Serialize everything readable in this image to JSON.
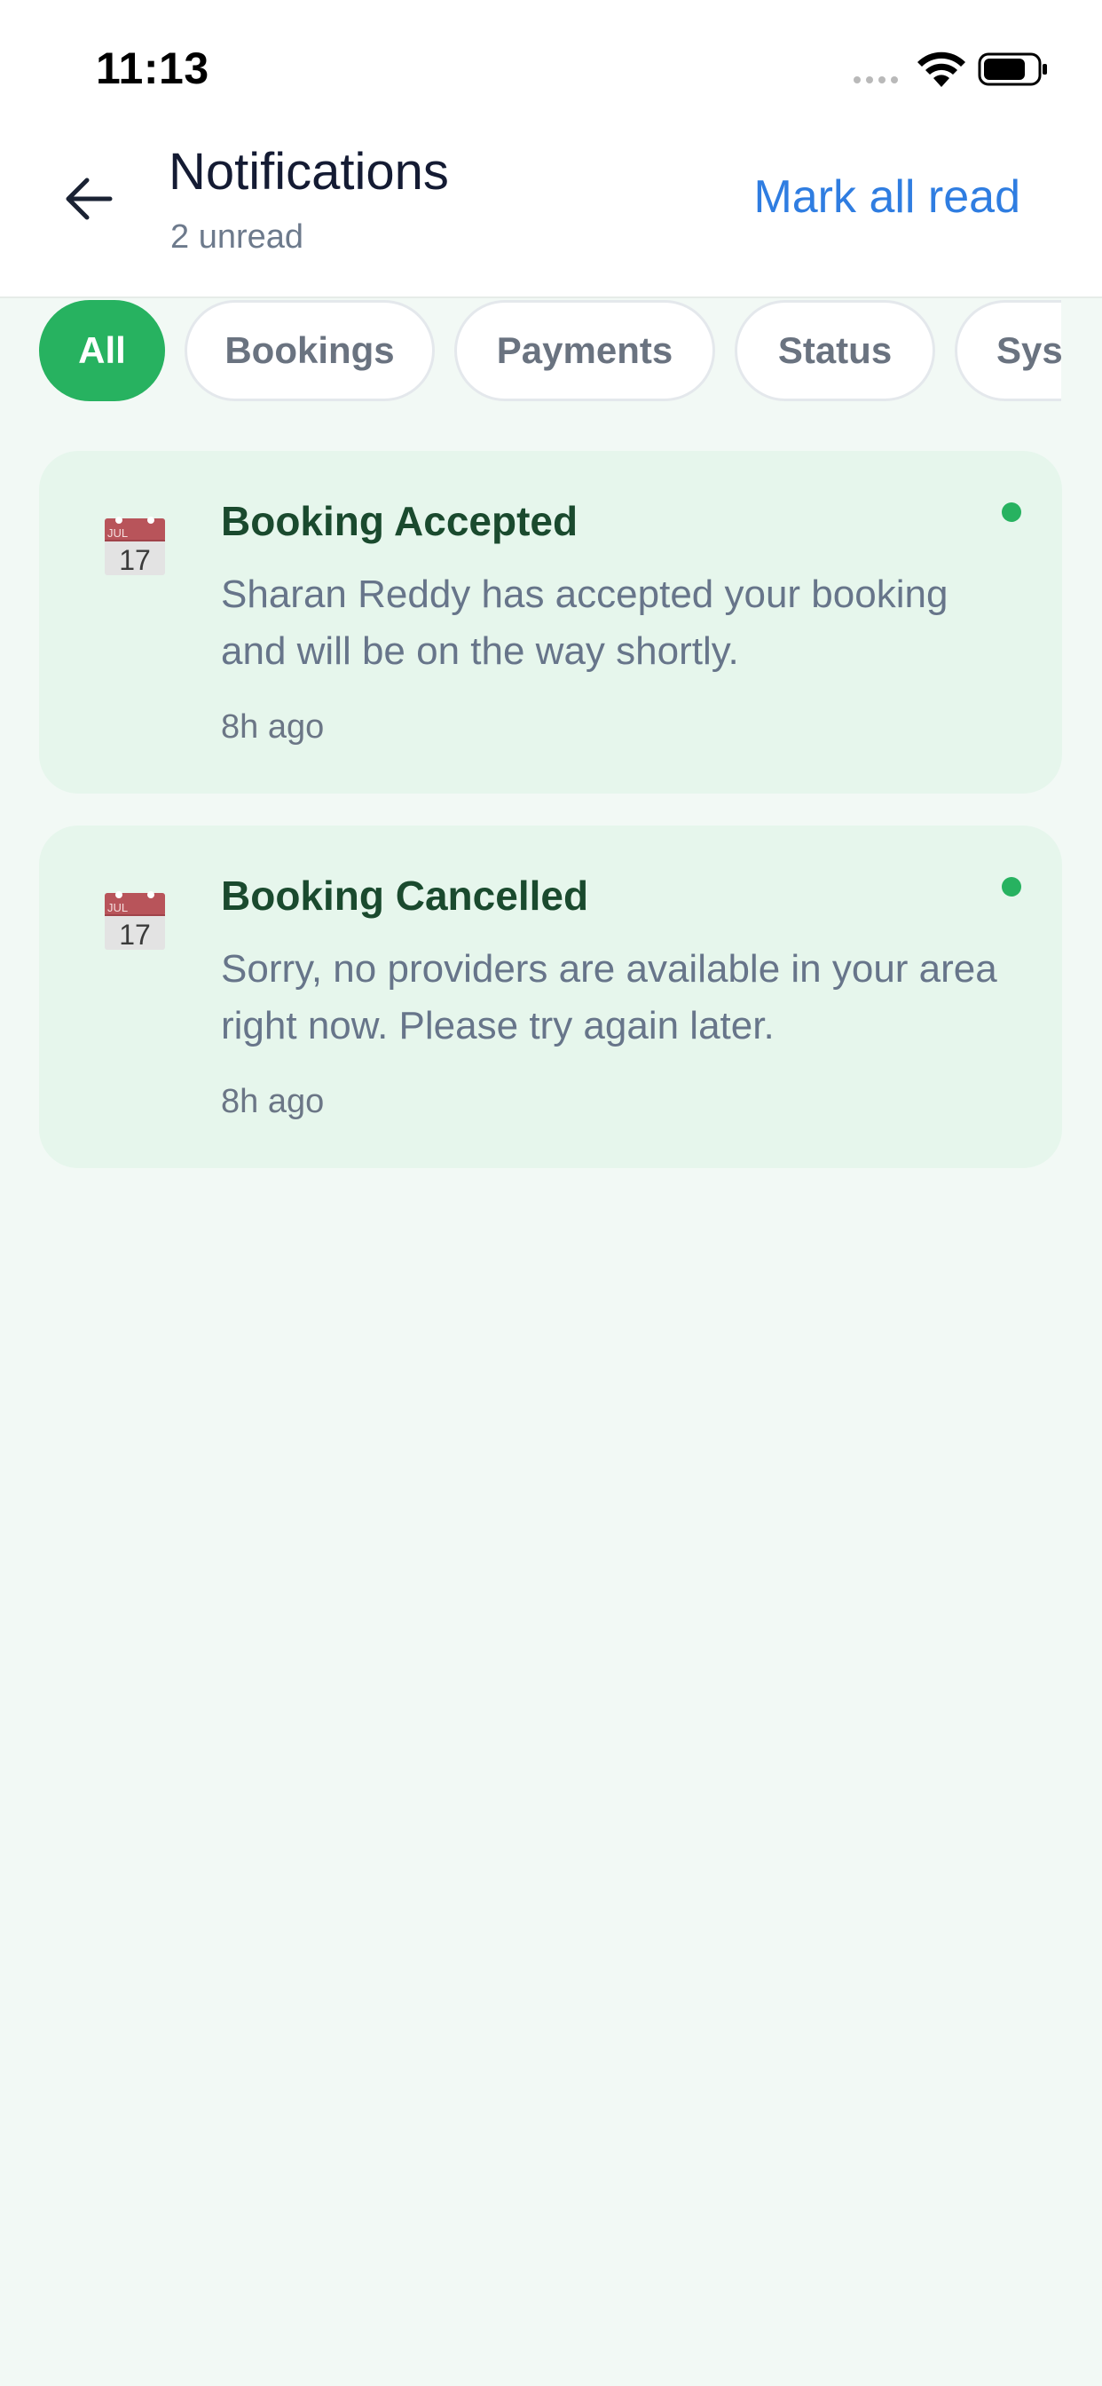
{
  "status_bar": {
    "time": "11:13"
  },
  "header": {
    "title": "Notifications",
    "subtitle": "2 unread",
    "mark_all_label": "Mark all read"
  },
  "filters": [
    {
      "label": "All",
      "active": true
    },
    {
      "label": "Bookings",
      "active": false
    },
    {
      "label": "Payments",
      "active": false
    },
    {
      "label": "Status",
      "active": false
    },
    {
      "label": "System",
      "active": false
    }
  ],
  "notifications": [
    {
      "icon": "calendar-icon",
      "calendar_month": "JUL",
      "calendar_day": "17",
      "title": "Booking Accepted",
      "message": "Sharan Reddy has accepted your booking and will be on the way shortly.",
      "time": "8h ago",
      "unread": true
    },
    {
      "icon": "calendar-icon",
      "calendar_month": "JUL",
      "calendar_day": "17",
      "title": "Booking Cancelled",
      "message": "Sorry, no providers are available in your area right now. Please try again later.",
      "time": "8h ago",
      "unread": true
    }
  ],
  "colors": {
    "accent_green": "#27b260",
    "link_blue": "#2f7de1",
    "card_bg": "#e6f6ec",
    "page_bg": "#f2f9f5",
    "title_green": "#1a4a2e"
  }
}
